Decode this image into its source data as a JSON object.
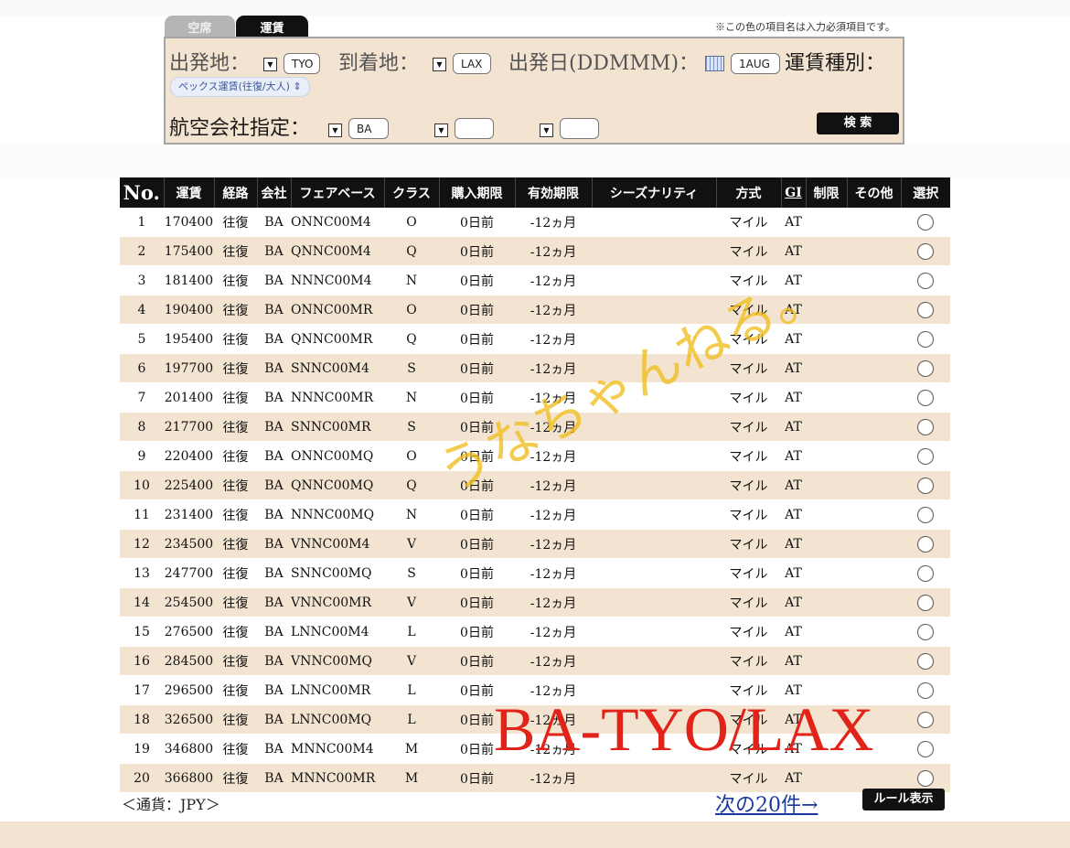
{
  "tabs": [
    {
      "label": "空席",
      "active": false
    },
    {
      "label": "運賃",
      "active": true
    }
  ],
  "required_note": "※この色の項目名は入力必須項目です。",
  "search": {
    "origin_label": "出発地：",
    "origin_value": "TYO",
    "destination_label": "到着地：",
    "destination_value": "LAX",
    "date_label": "出発日(DDMMM)：",
    "date_value": "1AUG",
    "fare_type_label": "運賃種別：",
    "fare_type_value": "ペックス運賃(往復/大人)",
    "airline_label": "航空会社指定：",
    "airline_values": [
      "BA",
      "",
      ""
    ],
    "search_button": "検 索"
  },
  "table": {
    "headers": [
      "No.",
      "運賃",
      "経路",
      "会社",
      "フェアベース",
      "クラス",
      "購入期限",
      "有効期限",
      "シーズナリティ",
      "方式",
      "GI",
      "制限",
      "その他",
      "選択"
    ],
    "rows": [
      [
        "1",
        "170400",
        "往復",
        "BA",
        "ONNC00M4",
        "O",
        "0日前",
        "-12ヵ月",
        "",
        "マイル",
        "AT",
        "",
        ""
      ],
      [
        "2",
        "175400",
        "往復",
        "BA",
        "QNNC00M4",
        "Q",
        "0日前",
        "-12ヵ月",
        "",
        "マイル",
        "AT",
        "",
        ""
      ],
      [
        "3",
        "181400",
        "往復",
        "BA",
        "NNNC00M4",
        "N",
        "0日前",
        "-12ヵ月",
        "",
        "マイル",
        "AT",
        "",
        ""
      ],
      [
        "4",
        "190400",
        "往復",
        "BA",
        "ONNC00MR",
        "O",
        "0日前",
        "-12ヵ月",
        "",
        "マイル",
        "AT",
        "",
        ""
      ],
      [
        "5",
        "195400",
        "往復",
        "BA",
        "QNNC00MR",
        "Q",
        "0日前",
        "-12ヵ月",
        "",
        "マイル",
        "AT",
        "",
        ""
      ],
      [
        "6",
        "197700",
        "往復",
        "BA",
        "SNNC00M4",
        "S",
        "0日前",
        "-12ヵ月",
        "",
        "マイル",
        "AT",
        "",
        ""
      ],
      [
        "7",
        "201400",
        "往復",
        "BA",
        "NNNC00MR",
        "N",
        "0日前",
        "-12ヵ月",
        "",
        "マイル",
        "AT",
        "",
        ""
      ],
      [
        "8",
        "217700",
        "往復",
        "BA",
        "SNNC00MR",
        "S",
        "0日前",
        "-12ヵ月",
        "",
        "マイル",
        "AT",
        "",
        ""
      ],
      [
        "9",
        "220400",
        "往復",
        "BA",
        "ONNC00MQ",
        "O",
        "0日前",
        "-12ヵ月",
        "",
        "マイル",
        "AT",
        "",
        ""
      ],
      [
        "10",
        "225400",
        "往復",
        "BA",
        "QNNC00MQ",
        "Q",
        "0日前",
        "-12ヵ月",
        "",
        "マイル",
        "AT",
        "",
        ""
      ],
      [
        "11",
        "231400",
        "往復",
        "BA",
        "NNNC00MQ",
        "N",
        "0日前",
        "-12ヵ月",
        "",
        "マイル",
        "AT",
        "",
        ""
      ],
      [
        "12",
        "234500",
        "往復",
        "BA",
        "VNNC00M4",
        "V",
        "0日前",
        "-12ヵ月",
        "",
        "マイル",
        "AT",
        "",
        ""
      ],
      [
        "13",
        "247700",
        "往復",
        "BA",
        "SNNC00MQ",
        "S",
        "0日前",
        "-12ヵ月",
        "",
        "マイル",
        "AT",
        "",
        ""
      ],
      [
        "14",
        "254500",
        "往復",
        "BA",
        "VNNC00MR",
        "V",
        "0日前",
        "-12ヵ月",
        "",
        "マイル",
        "AT",
        "",
        ""
      ],
      [
        "15",
        "276500",
        "往復",
        "BA",
        "LNNC00M4",
        "L",
        "0日前",
        "-12ヵ月",
        "",
        "マイル",
        "AT",
        "",
        ""
      ],
      [
        "16",
        "284500",
        "往復",
        "BA",
        "VNNC00MQ",
        "V",
        "0日前",
        "-12ヵ月",
        "",
        "マイル",
        "AT",
        "",
        ""
      ],
      [
        "17",
        "296500",
        "往復",
        "BA",
        "LNNC00MR",
        "L",
        "0日前",
        "-12ヵ月",
        "",
        "マイル",
        "AT",
        "",
        ""
      ],
      [
        "18",
        "326500",
        "往復",
        "BA",
        "LNNC00MQ",
        "L",
        "0日前",
        "-12ヵ月",
        "",
        "マイル",
        "AT",
        "",
        ""
      ],
      [
        "19",
        "346800",
        "往復",
        "BA",
        "MNNC00M4",
        "M",
        "0日前",
        "-12ヵ月",
        "",
        "マイル",
        "AT",
        "",
        ""
      ],
      [
        "20",
        "366800",
        "往復",
        "BA",
        "MNNC00MR",
        "M",
        "0日前",
        "-12ヵ月",
        "",
        "マイル",
        "AT",
        "",
        ""
      ]
    ]
  },
  "footer": {
    "currency": "＜通貨：JPY＞",
    "next_link": "次の20件→",
    "rule_button": "ルール表示"
  },
  "watermarks": {
    "handwritten": "うなちゃんねる。",
    "route": "BA-TYO/LAX"
  },
  "colors": {
    "panel_bg": "#f3e4d1",
    "header_bg": "#111111",
    "row_alt_bg": "#f3e4d1",
    "link": "#1c3a9c",
    "watermark_red": "#e2231a",
    "watermark_yellow": "#f0be1e"
  }
}
